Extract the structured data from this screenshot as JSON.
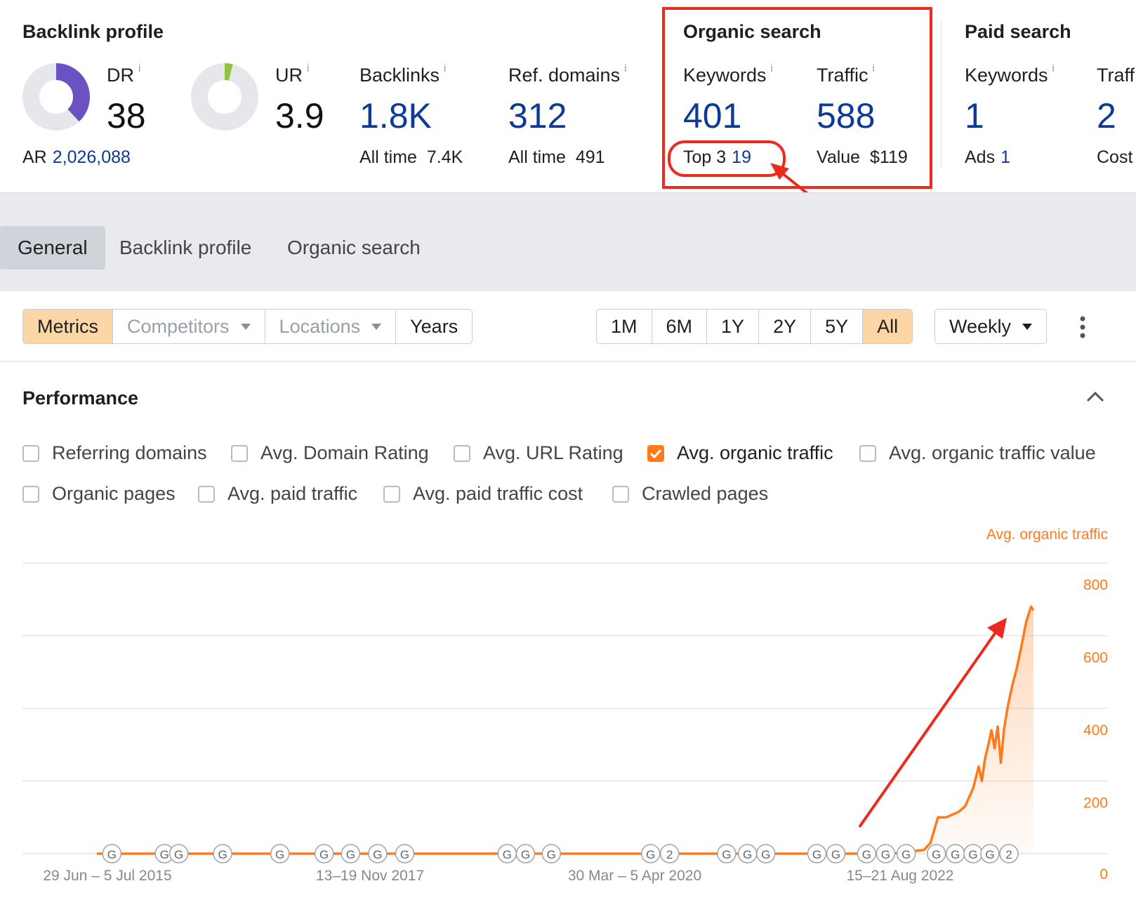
{
  "backlink_profile": {
    "title": "Backlink profile",
    "dr": {
      "label": "DR",
      "value": "38",
      "fraction": 0.38
    },
    "ur": {
      "label": "UR",
      "value": "3.9",
      "fraction": 0.039
    },
    "ar": {
      "label": "AR",
      "value": "2,026,088"
    },
    "backlinks": {
      "label": "Backlinks",
      "value": "1.8K",
      "sub_label": "All time",
      "sub_value": "7.4K"
    },
    "ref_domains": {
      "label": "Ref. domains",
      "value": "312",
      "sub_label": "All time",
      "sub_value": "491"
    }
  },
  "organic_search": {
    "title": "Organic search",
    "keywords": {
      "label": "Keywords",
      "value": "401",
      "sub_label": "Top 3",
      "sub_value": "19"
    },
    "traffic": {
      "label": "Traffic",
      "value": "588",
      "sub_label": "Value",
      "sub_value": "$119"
    }
  },
  "paid_search": {
    "title": "Paid search",
    "keywords": {
      "label": "Keywords",
      "value": "1",
      "sub_label": "Ads",
      "sub_value": "1"
    },
    "traffic": {
      "label": "Traff",
      "value": "2",
      "sub_label": "Cost"
    }
  },
  "info_glyph": "i",
  "tabs": [
    {
      "label": "General",
      "active": true
    },
    {
      "label": "Backlink profile",
      "active": false
    },
    {
      "label": "Organic search",
      "active": false
    }
  ],
  "toolbar": {
    "metrics": "Metrics",
    "competitors": "Competitors",
    "locations": "Locations",
    "years": "Years",
    "ranges": [
      "1M",
      "6M",
      "1Y",
      "2Y",
      "5Y",
      "All"
    ],
    "active_range": "All",
    "interval": "Weekly"
  },
  "performance": {
    "title": "Performance",
    "checkboxes_row1": [
      {
        "label": "Referring domains",
        "checked": false
      },
      {
        "label": "Avg. Domain Rating",
        "checked": false
      },
      {
        "label": "Avg. URL Rating",
        "checked": false
      },
      {
        "label": "Avg. organic traffic",
        "checked": true
      },
      {
        "label": "Avg. organic traffic value",
        "checked": false
      }
    ],
    "checkboxes_row2": [
      {
        "label": "Organic pages",
        "checked": false
      },
      {
        "label": "Avg. paid traffic",
        "checked": false
      },
      {
        "label": "Avg. paid traffic cost",
        "checked": false
      },
      {
        "label": "Crawled pages",
        "checked": false
      }
    ]
  },
  "colors": {
    "accent": "#ff7a1a",
    "dr_ring": "#6a52c2",
    "ur_ring": "#8cc63f",
    "link_blue": "#0c3a96",
    "annotation_red": "#ee2a1c"
  },
  "chart_data": {
    "type": "area",
    "series": [
      {
        "name": "Avg. organic traffic",
        "color": "#ff7a1a"
      }
    ],
    "ylim": [
      0,
      800
    ],
    "y_ticks": [
      "800",
      "600",
      "400",
      "200",
      "0"
    ],
    "x_tick_labels": [
      "29 Jun – 5 Jul 2015",
      "13–19 Nov 2017",
      "30 Mar – 5 Apr 2020",
      "15–21 Aug 2022"
    ],
    "x_range": [
      "2015-06-29",
      "2023-08-28"
    ],
    "grid": true,
    "points": [
      [
        "2015-06-29",
        0
      ],
      [
        "2022-06-01",
        0
      ],
      [
        "2022-07-15",
        5
      ],
      [
        "2022-09-10",
        10
      ],
      [
        "2022-10-01",
        30
      ],
      [
        "2022-10-25",
        100
      ],
      [
        "2022-11-20",
        100
      ],
      [
        "2022-12-30",
        115
      ],
      [
        "2023-01-20",
        130
      ],
      [
        "2023-02-15",
        180
      ],
      [
        "2023-03-05",
        240
      ],
      [
        "2023-03-15",
        200
      ],
      [
        "2023-03-25",
        260
      ],
      [
        "2023-04-05",
        300
      ],
      [
        "2023-04-15",
        340
      ],
      [
        "2023-04-25",
        290
      ],
      [
        "2023-05-05",
        350
      ],
      [
        "2023-05-15",
        250
      ],
      [
        "2023-05-25",
        340
      ],
      [
        "2023-06-05",
        400
      ],
      [
        "2023-06-20",
        460
      ],
      [
        "2023-07-05",
        510
      ],
      [
        "2023-07-20",
        570
      ],
      [
        "2023-08-05",
        640
      ],
      [
        "2023-08-20",
        680
      ],
      [
        "2023-08-28",
        670
      ]
    ],
    "event_markers": [
      {
        "date": "2015-07-20",
        "label": "G"
      },
      {
        "date": "2016-01-05",
        "label": "G"
      },
      {
        "date": "2016-02-20",
        "label": "G"
      },
      {
        "date": "2016-07-10",
        "label": "G"
      },
      {
        "date": "2017-01-10",
        "label": "G"
      },
      {
        "date": "2017-06-01",
        "label": "G"
      },
      {
        "date": "2017-08-25",
        "label": "G"
      },
      {
        "date": "2017-11-20",
        "label": "G"
      },
      {
        "date": "2018-02-15",
        "label": "G"
      },
      {
        "date": "2019-01-10",
        "label": "G"
      },
      {
        "date": "2019-03-10",
        "label": "G"
      },
      {
        "date": "2019-06-01",
        "label": "G"
      },
      {
        "date": "2020-04-15",
        "label": "G"
      },
      {
        "date": "2020-06-15",
        "label": "2"
      },
      {
        "date": "2020-12-15",
        "label": "G"
      },
      {
        "date": "2021-02-20",
        "label": "G"
      },
      {
        "date": "2021-04-20",
        "label": "G"
      },
      {
        "date": "2021-10-01",
        "label": "G"
      },
      {
        "date": "2021-12-01",
        "label": "G"
      },
      {
        "date": "2022-03-10",
        "label": "G"
      },
      {
        "date": "2022-05-10",
        "label": "G"
      },
      {
        "date": "2022-07-15",
        "label": "G"
      },
      {
        "date": "2022-10-20",
        "label": "G"
      },
      {
        "date": "2022-12-20",
        "label": "G"
      },
      {
        "date": "2023-02-15",
        "label": "G"
      },
      {
        "date": "2023-04-10",
        "label": "G"
      },
      {
        "date": "2023-06-10",
        "label": "2"
      }
    ]
  }
}
